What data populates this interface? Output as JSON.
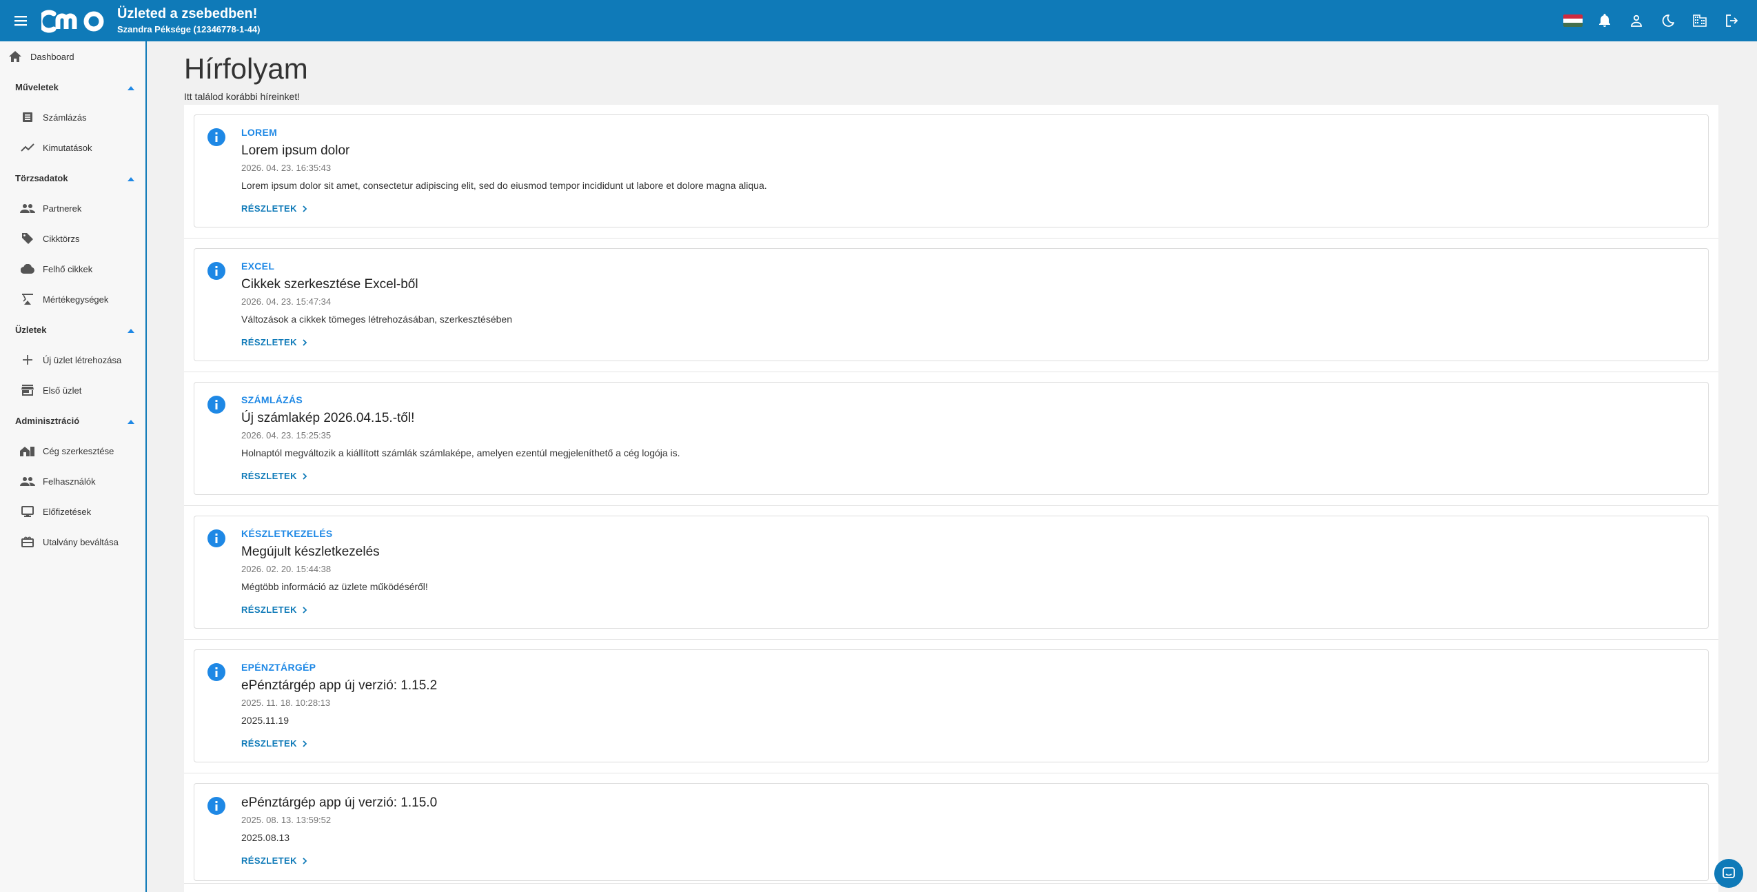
{
  "header": {
    "title": "Üzleted a zsebedben!",
    "subtitle": "Szandra Péksége (12346778-1-44)",
    "logo_text": "cmo"
  },
  "sidebar": {
    "dashboard": "Dashboard",
    "groups": [
      {
        "label": "Műveletek",
        "items": [
          "Számlázás",
          "Kimutatások"
        ]
      },
      {
        "label": "Törzsadatok",
        "items": [
          "Partnerek",
          "Cikktörzs",
          "Felhő cikkek",
          "Mértékegységek"
        ]
      },
      {
        "label": "Üzletek",
        "items": [
          "Új üzlet létrehozása",
          "Első üzlet"
        ]
      },
      {
        "label": "Adminisztráció",
        "items": [
          "Cég szerkesztése",
          "Felhasználók",
          "Előfizetések",
          "Utalvány beváltása"
        ]
      }
    ]
  },
  "page": {
    "title": "Hírfolyam",
    "subtitle": "Itt találod korábbi híreinket!"
  },
  "news": [
    {
      "category": "LOREM",
      "title": "Lorem ipsum dolor",
      "date": "2026. 04. 23. 16:35:43",
      "text": "Lorem ipsum dolor sit amet, consectetur adipiscing elit, sed do eiusmod tempor incididunt ut labore et dolore magna aliqua.",
      "link": "RÉSZLETEK"
    },
    {
      "category": "EXCEL",
      "title": "Cikkek szerkesztése Excel-ből",
      "date": "2026. 04. 23. 15:47:34",
      "text": "Változások a cikkek tömeges létrehozásában, szerkesztésében",
      "link": "RÉSZLETEK"
    },
    {
      "category": "SZÁMLÁZÁS",
      "title": "Új számlakép 2026.04.15.-től!",
      "date": "2026. 04. 23. 15:25:35",
      "text": "Holnaptól megváltozik a kiállított számlák számlaképe, amelyen ezentúl megjeleníthető a cég logója is.",
      "link": "RÉSZLETEK"
    },
    {
      "category": "KÉSZLETKEZELÉS",
      "title": "Megújult készletkezelés",
      "date": "2026. 02. 20. 15:44:38",
      "text": "Mégtöbb információ az üzlete működéséről!",
      "link": "RÉSZLETEK"
    },
    {
      "category": "EPÉNZTÁRGÉP",
      "title": "ePénztárgép app új verzió: 1.15.2",
      "date": "2025. 11. 18. 10:28:13",
      "text": "2025.11.19",
      "link": "RÉSZLETEK"
    },
    {
      "category": "",
      "title": "ePénztárgép app új verzió: 1.15.0",
      "date": "2025. 08. 13. 13:59:52",
      "text": "2025.08.13",
      "link": "RÉSZLETEK"
    }
  ],
  "colors": {
    "brand": "#0f7ab8",
    "accent": "#1e88e5",
    "background": "#f1f1f1"
  }
}
